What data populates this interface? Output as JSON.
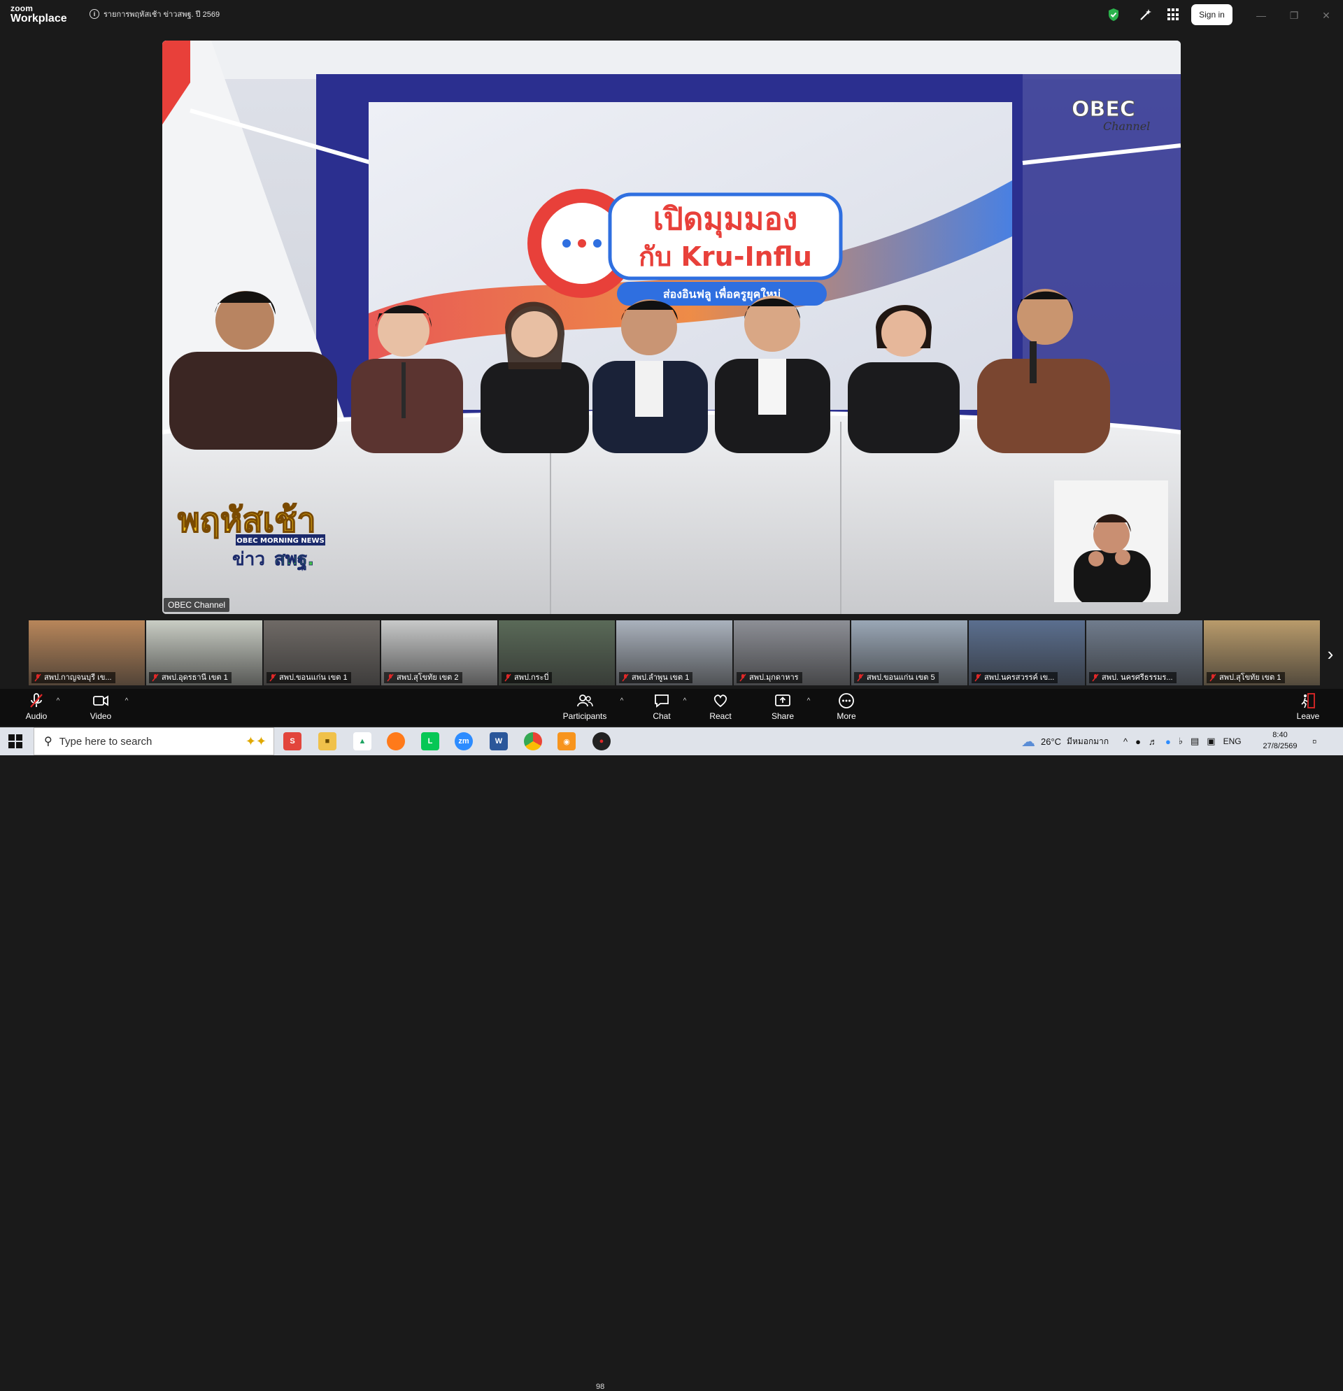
{
  "app": {
    "logo_top": "zoom",
    "logo_bottom": "Workplace"
  },
  "meeting": {
    "title": "รายการพฤหัสเช้า ข่าวสพฐ. ปี 2569"
  },
  "header": {
    "signin_label": "Sign in"
  },
  "video": {
    "speaker_name": "OBEC Channel",
    "studio_title_line1": "เปิดมุมมอง",
    "studio_title_line2": "กับ Kru-Influ",
    "studio_subtitle": "ส่องอินฟลู เพื่อครูยุคใหม่",
    "channel_logo_top": "OBEC",
    "channel_logo_bottom": "Channel",
    "show_logo_main": "พฤหัสเช้า",
    "show_logo_band": "OBEC MORNING NEWS",
    "show_logo_bottom_a": "ข่าว",
    "show_logo_bottom_b": "สพฐ."
  },
  "gallery": [
    {
      "name": "สพป.กาญจนบุรี เข...",
      "bg": "#b8865a"
    },
    {
      "name": "สพป.อุดรธานี เขต 1",
      "bg": "#c9cdc4"
    },
    {
      "name": "สพป.ขอนแก่น เขต 1",
      "bg": "#6f6a66"
    },
    {
      "name": "สพป.สุโขทัย เขต 2",
      "bg": "#c8c9c9"
    },
    {
      "name": "สพป.กระบี่",
      "bg": "#5a6a58"
    },
    {
      "name": "สพป.ลำพูน เขต 1",
      "bg": "#aab2bd"
    },
    {
      "name": "สพป.มุกดาหาร",
      "bg": "#8d8f96"
    },
    {
      "name": "สพป.ขอนแก่น เขต 5",
      "bg": "#9aa7b6"
    },
    {
      "name": "สพป.นครสวรรค์ เข...",
      "bg": "#5b6f8f"
    },
    {
      "name": "สพป. นครศรีธรรมร...",
      "bg": "#707c8d"
    },
    {
      "name": "สพป.สุโขทัย เขต 1",
      "bg": "#b99b6b"
    }
  ],
  "toolbar": {
    "audio": "Audio",
    "video": "Video",
    "participants": "Participants",
    "participants_count": "98",
    "chat": "Chat",
    "react": "React",
    "share": "Share",
    "more": "More",
    "leave": "Leave"
  },
  "taskbar": {
    "search_placeholder": "Type here to search",
    "weather": "26°C",
    "weather_desc": "มีหมอกมาก",
    "language": "ENG",
    "time": "8:40",
    "date": "27/8/2569"
  },
  "colors": {
    "toolbar_bg": "#0e0e0e",
    "titlebar_bg": "#1a1a1a",
    "shield_green": "#2bb24c",
    "leave_red": "#e02828",
    "studio_navy": "#2b2f8f"
  }
}
